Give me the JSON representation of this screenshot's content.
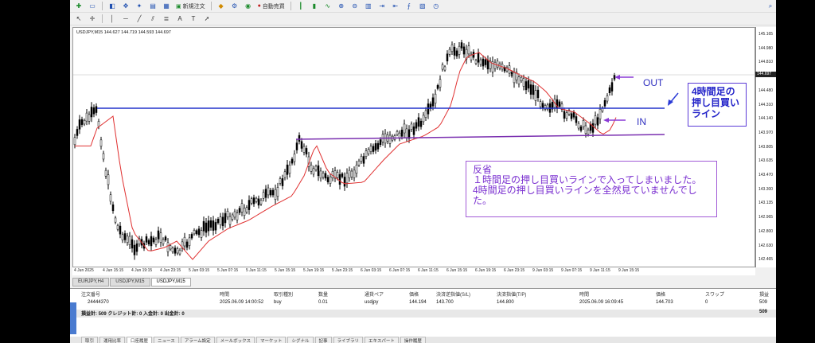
{
  "toolbar": {
    "new_order_label": "新規注文",
    "auto_trade_label": "自動売買"
  },
  "chart": {
    "title": "USDJPY,M15  144.627 144.719 144.593 144.697",
    "current_price": "144.697",
    "price_ticks": [
      "145.165",
      "144.980",
      "144.810",
      "144.645",
      "144.480",
      "144.310",
      "144.140",
      "143.970",
      "143.805",
      "143.635",
      "143.470",
      "143.300",
      "143.135",
      "142.965",
      "142.800",
      "142.630",
      "142.465"
    ],
    "time_ticks": [
      "4 Jun 2025",
      "4 Jun 15:15",
      "4 Jun 19:15",
      "4 Jun 23:15",
      "5 Jun 03:15",
      "5 Jun 07:15",
      "5 Jun 11:15",
      "5 Jun 15:15",
      "5 Jun 19:15",
      "5 Jun 23:15",
      "6 Jun 03:15",
      "6 Jun 07:15",
      "6 Jun 11:15",
      "6 Jun 15:15",
      "6 Jun 19:15",
      "6 Jun 23:15",
      "9 Jun 03:15",
      "9 Jun 07:15",
      "9 Jun 11:15",
      "9 Jun 15:15"
    ],
    "line_color_4h": "#2233cc",
    "line_color_1h": "#7a2fb0",
    "ma_color": "#e03030"
  },
  "annotations": {
    "out": "OUT",
    "in": "IN",
    "label_4h": [
      "4時間足の",
      "押し目買い",
      "ライン"
    ],
    "note_title": "反省",
    "note_line1": "１時間足の押し目買いラインで入ってしまいました。",
    "note_line2": "4時間足の押し目買いラインを全然見ていませんでした。"
  },
  "chart_tabs": [
    "EURJPY,H4",
    "USDJPY,M15",
    "USDJPY,M15"
  ],
  "terminal": {
    "headers": [
      "注文番号",
      "時間",
      "取引種別",
      "数量",
      "通貨ペア",
      "価格",
      "決済逆指値(S/L)",
      "決済指値(T/P)",
      "時間",
      "価格",
      "スワップ",
      "損益"
    ],
    "row": [
      "24444370",
      "2025.06.09 14:00:52",
      "buy",
      "0.01",
      "usdjpy",
      "144.194",
      "143.700",
      "144.800",
      "2025.06.09 16:09:45",
      "144.703",
      "0",
      "509"
    ],
    "summary": "損益計: 509  クレジット計: 0  入金計: 0  出金計: 0",
    "summary_value": "509"
  },
  "bottom_tabs": [
    "取引",
    "運用比率",
    "口座履歴",
    "ニュース",
    "アラーム設定",
    "メールボックス",
    "マーケット",
    "シグナル",
    "記事",
    "ライブラリ",
    "エキスパート",
    "操作履歴"
  ]
}
